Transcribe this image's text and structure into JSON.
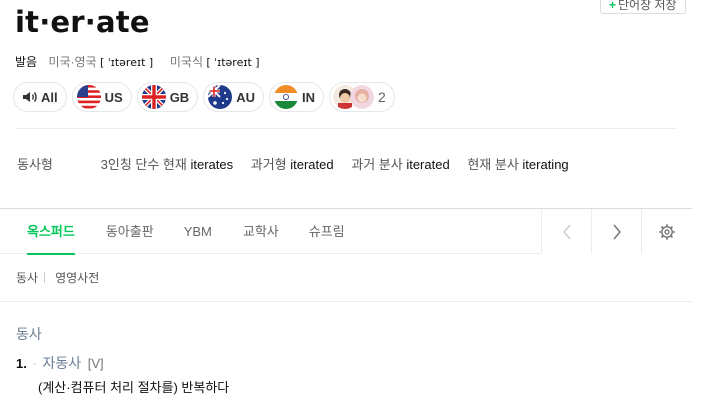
{
  "save_button": {
    "plus": "+",
    "label": "단어장 저장"
  },
  "headword": "it·er·ate",
  "pronunciation": {
    "label": "발음",
    "us_uk_label": "미국·영국",
    "us_uk_ipa": "[ ˈɪtəreɪt ]",
    "us_label": "미국식",
    "us_ipa": "[ ˈɪtəreɪt ]"
  },
  "audio": {
    "all": "All",
    "us": "US",
    "gb": "GB",
    "au": "AU",
    "in": "IN",
    "user_count": "2"
  },
  "conjugation": {
    "label": "동사형",
    "items": [
      {
        "k": "3인칭 단수 현재",
        "v": "iterates"
      },
      {
        "k": "과거형",
        "v": "iterated"
      },
      {
        "k": "과거 분사",
        "v": "iterated"
      },
      {
        "k": "현재 분사",
        "v": "iterating"
      }
    ]
  },
  "tabs": [
    "옥스퍼드",
    "동아출판",
    "YBM",
    "교학사",
    "슈프림"
  ],
  "sub": {
    "pos": "동사",
    "source": "영영사전"
  },
  "entry": {
    "pos": "동사",
    "sense_num": "1.",
    "sense_dot": "·",
    "gram": "자동사",
    "code": "[V]",
    "meaning": "(계산·컴퓨터 처리 절차를) 반복하다"
  },
  "colors": {
    "accent": "#03c75a",
    "pos": "#6b7d92"
  }
}
